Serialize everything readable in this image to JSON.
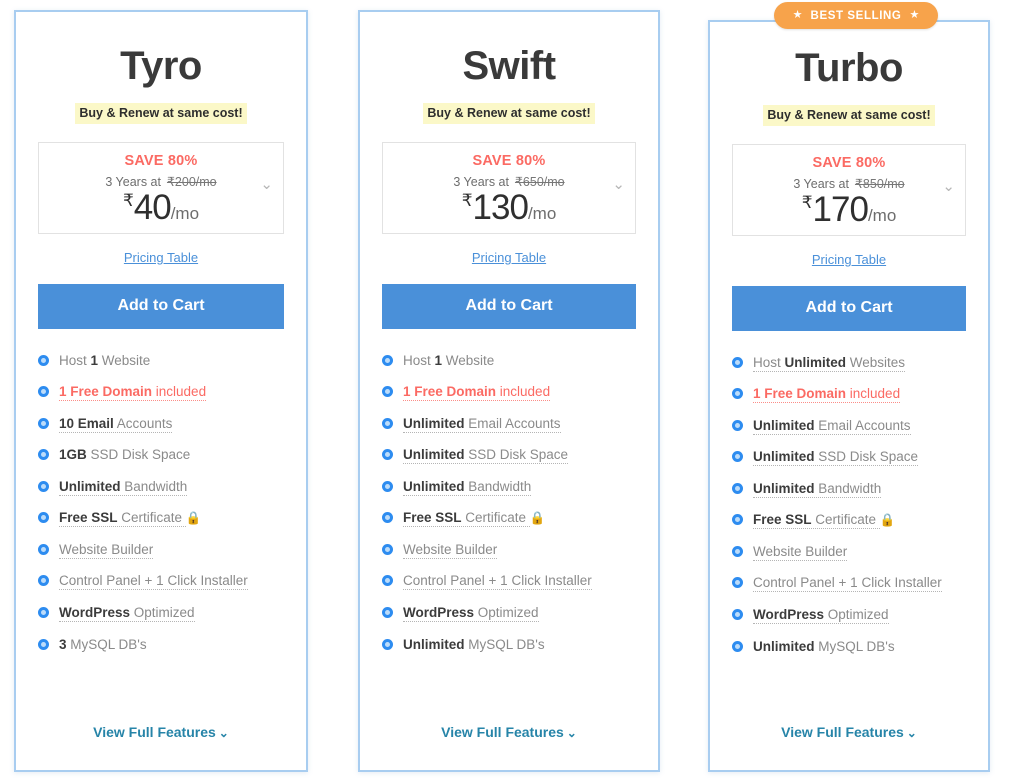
{
  "badge": {
    "text": "BEST SELLING",
    "star": "★",
    "color": "#f7a34b"
  },
  "common": {
    "tagline": "Buy & Renew at same cost!",
    "save_label": "SAVE 80%",
    "term_prefix": "3 Years at",
    "rupee": "₹",
    "per_month": "/mo",
    "pricing_table_link": "Pricing Table",
    "cart_label": "Add to Cart",
    "view_full_label": "View Full Features",
    "chevron": "⌄",
    "lock_icon": "🔒",
    "accent_blue": "#4a90d9",
    "save_red": "#fb6a63",
    "bullet_blue": "#2d8cf0",
    "highlight_yellow": "#fbf8c8",
    "border_blue": "#a8cdf0",
    "link_teal": "#2684a8"
  },
  "plans": [
    {
      "name": "Tyro",
      "old_price": "₹200/mo",
      "price": "40",
      "features": [
        {
          "pre": "Host ",
          "bold": "1",
          "post": " Website",
          "dotted": false,
          "red": false,
          "lock": false
        },
        {
          "pre": "",
          "bold": "1 Free Domain",
          "post": " included",
          "dotted": true,
          "red": true,
          "lock": false
        },
        {
          "pre": "",
          "bold": "10 Email",
          "post": " Accounts",
          "dotted": true,
          "red": false,
          "lock": false
        },
        {
          "pre": "",
          "bold": "1GB",
          "post": " SSD Disk Space",
          "dotted": false,
          "red": false,
          "lock": false
        },
        {
          "pre": "",
          "bold": "Unlimited",
          "post": " Bandwidth",
          "dotted": true,
          "red": false,
          "lock": false
        },
        {
          "pre": "",
          "bold": "Free SSL",
          "post": " Certificate ",
          "dotted": true,
          "red": false,
          "lock": true
        },
        {
          "pre": "Website Builder",
          "bold": "",
          "post": "",
          "dotted": true,
          "red": false,
          "lock": false
        },
        {
          "pre": "Control Panel + 1 Click Installer",
          "bold": "",
          "post": "",
          "dotted": true,
          "red": false,
          "lock": false
        },
        {
          "pre": "",
          "bold": "WordPress",
          "post": " Optimized",
          "dotted": true,
          "red": false,
          "lock": false
        },
        {
          "pre": "",
          "bold": "3",
          "post": " MySQL DB's",
          "dotted": false,
          "red": false,
          "lock": false
        }
      ]
    },
    {
      "name": "Swift",
      "old_price": "₹650/mo",
      "price": "130",
      "features": [
        {
          "pre": "Host ",
          "bold": "1",
          "post": " Website",
          "dotted": false,
          "red": false,
          "lock": false
        },
        {
          "pre": "",
          "bold": "1 Free Domain",
          "post": " included",
          "dotted": true,
          "red": true,
          "lock": false
        },
        {
          "pre": "",
          "bold": "Unlimited",
          "post": " Email Accounts",
          "dotted": true,
          "red": false,
          "lock": false
        },
        {
          "pre": "",
          "bold": "Unlimited",
          "post": " SSD Disk Space",
          "dotted": true,
          "red": false,
          "lock": false
        },
        {
          "pre": "",
          "bold": "Unlimited",
          "post": " Bandwidth",
          "dotted": true,
          "red": false,
          "lock": false
        },
        {
          "pre": "",
          "bold": "Free SSL",
          "post": " Certificate ",
          "dotted": true,
          "red": false,
          "lock": true
        },
        {
          "pre": "Website Builder",
          "bold": "",
          "post": "",
          "dotted": true,
          "red": false,
          "lock": false
        },
        {
          "pre": "Control Panel + 1 Click Installer",
          "bold": "",
          "post": "",
          "dotted": true,
          "red": false,
          "lock": false
        },
        {
          "pre": "",
          "bold": "WordPress",
          "post": " Optimized",
          "dotted": true,
          "red": false,
          "lock": false
        },
        {
          "pre": "",
          "bold": "Unlimited",
          "post": " MySQL DB's",
          "dotted": false,
          "red": false,
          "lock": false
        }
      ]
    },
    {
      "name": "Turbo",
      "old_price": "₹850/mo",
      "price": "170",
      "best_selling": true,
      "features": [
        {
          "pre": "Host ",
          "bold": "Unlimited",
          "post": " Websites",
          "dotted": true,
          "red": false,
          "lock": false
        },
        {
          "pre": "",
          "bold": "1 Free Domain",
          "post": " included",
          "dotted": true,
          "red": true,
          "lock": false
        },
        {
          "pre": "",
          "bold": "Unlimited",
          "post": " Email Accounts",
          "dotted": true,
          "red": false,
          "lock": false
        },
        {
          "pre": "",
          "bold": "Unlimited",
          "post": " SSD Disk Space",
          "dotted": true,
          "red": false,
          "lock": false
        },
        {
          "pre": "",
          "bold": "Unlimited",
          "post": " Bandwidth",
          "dotted": true,
          "red": false,
          "lock": false
        },
        {
          "pre": "",
          "bold": "Free SSL",
          "post": " Certificate ",
          "dotted": true,
          "red": false,
          "lock": true
        },
        {
          "pre": "Website Builder",
          "bold": "",
          "post": "",
          "dotted": true,
          "red": false,
          "lock": false
        },
        {
          "pre": "Control Panel + 1 Click Installer",
          "bold": "",
          "post": "",
          "dotted": true,
          "red": false,
          "lock": false
        },
        {
          "pre": "",
          "bold": "WordPress",
          "post": " Optimized",
          "dotted": true,
          "red": false,
          "lock": false
        },
        {
          "pre": "",
          "bold": "Unlimited",
          "post": " MySQL DB's",
          "dotted": false,
          "red": false,
          "lock": false
        }
      ]
    }
  ]
}
